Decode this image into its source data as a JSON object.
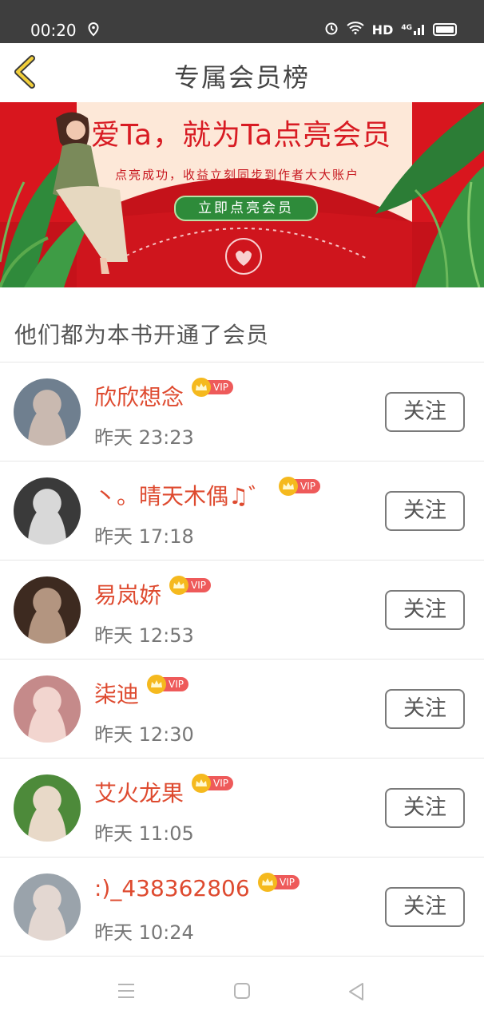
{
  "status_bar": {
    "time": "00:20",
    "network": "HD",
    "signal": "4G"
  },
  "header": {
    "title": "专属会员榜"
  },
  "banner": {
    "headline": "爱Ta，就为Ta点亮会员",
    "subtitle": "点亮成功，收益立刻同步到作者大大账户",
    "cta": "立即点亮会员"
  },
  "section": {
    "title": "他们都为本书开通了会员"
  },
  "vip_label": "VIP",
  "follow_label": "关注",
  "members": [
    {
      "name": "欣欣想念",
      "time": "昨天 23:23",
      "avatar_colors": [
        "#6f7f8f",
        "#c9b9b0"
      ]
    },
    {
      "name": "丶。晴天木偶♫゛",
      "time": "昨天 17:18",
      "avatar_colors": [
        "#3a3a3a",
        "#d8d8d8"
      ]
    },
    {
      "name": "易岚娇",
      "time": "昨天 12:53",
      "avatar_colors": [
        "#3d2a20",
        "#b39580"
      ]
    },
    {
      "name": "柒迪",
      "time": "昨天 12:30",
      "avatar_colors": [
        "#c58a8a",
        "#f2d5cf"
      ]
    },
    {
      "name": "艾火龙果",
      "time": "昨天 11:05",
      "avatar_colors": [
        "#4d8a3a",
        "#e8d9c8"
      ]
    },
    {
      "name": ":)_438362806",
      "time": "昨天 10:24",
      "avatar_colors": [
        "#9aa3ab",
        "#e3d7d1"
      ]
    }
  ],
  "colors": {
    "accent_name": "#de4a2f",
    "banner_red": "#d8161e",
    "vip_red": "#ee5a5a",
    "crown_gold": "#f5b91e"
  }
}
